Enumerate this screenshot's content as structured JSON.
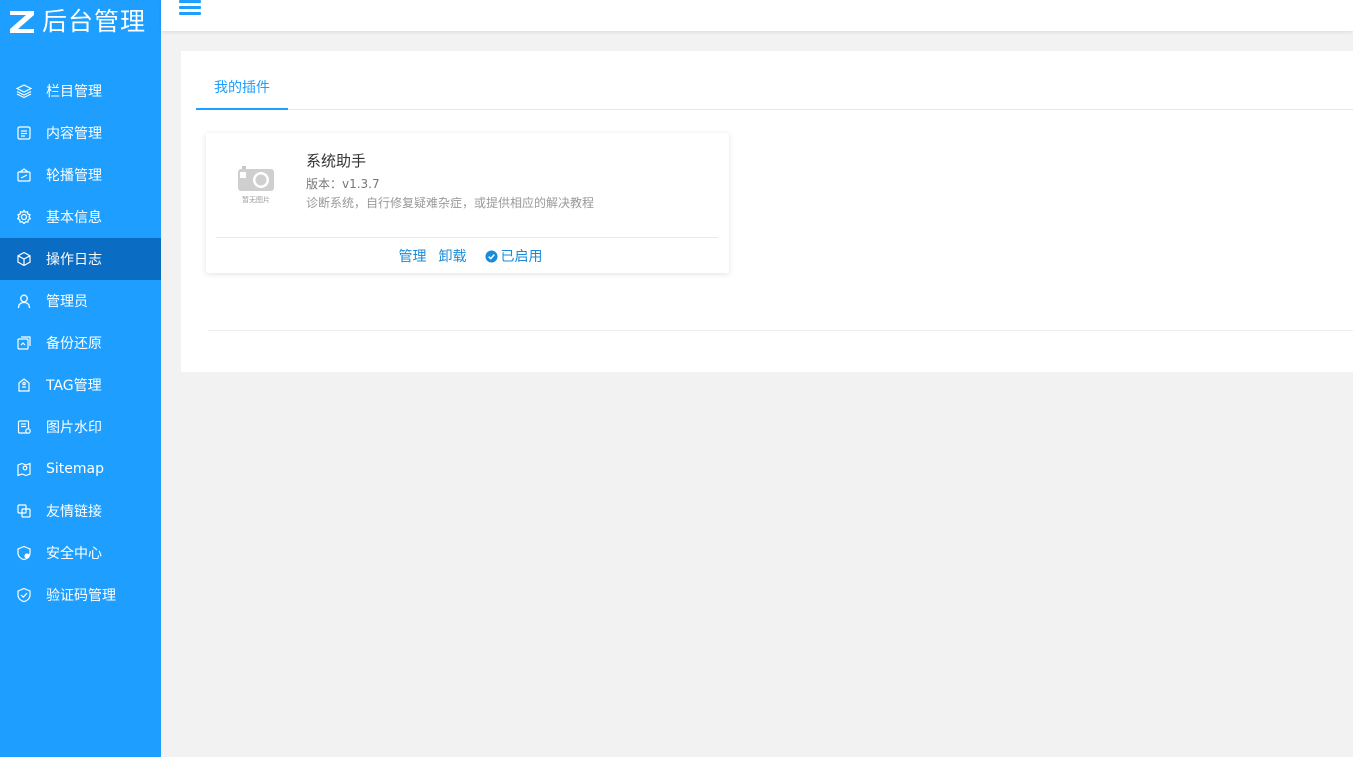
{
  "app": {
    "logo_text": "后台管理"
  },
  "sidebar": {
    "items": [
      {
        "label": "栏目管理",
        "icon": "layers-icon"
      },
      {
        "label": "内容管理",
        "icon": "document-icon"
      },
      {
        "label": "轮播管理",
        "icon": "carousel-icon"
      },
      {
        "label": "基本信息",
        "icon": "gear-icon"
      },
      {
        "label": "操作日志",
        "icon": "cube-icon",
        "active": true
      },
      {
        "label": "管理员",
        "icon": "user-icon"
      },
      {
        "label": "备份还原",
        "icon": "backup-icon"
      },
      {
        "label": "TAG管理",
        "icon": "tag-icon"
      },
      {
        "label": "图片水印",
        "icon": "watermark-icon"
      },
      {
        "label": "Sitemap",
        "icon": "map-icon"
      },
      {
        "label": "友情链接",
        "icon": "link-icon"
      },
      {
        "label": "安全中心",
        "icon": "security-shield-icon"
      },
      {
        "label": "验证码管理",
        "icon": "shield-check-icon"
      }
    ]
  },
  "header": {
    "menu_toggle_icon": "hamburger-icon"
  },
  "main": {
    "tabs": [
      {
        "label": "我的插件",
        "active": true
      }
    ],
    "plugins": [
      {
        "thumb_caption": "暂无图片",
        "name": "系统助手",
        "version": "版本：v1.3.7",
        "description": "诊断系统，自行修复疑难杂症，或提供相应的解决教程",
        "actions": {
          "manage": "管理",
          "uninstall": "卸载",
          "status": "已启用"
        }
      }
    ]
  },
  "colors": {
    "sidebar_bg": "#1e9fff",
    "sidebar_active": "#0b6cc4",
    "accent": "#1e9fff",
    "link": "#1a8bd8"
  }
}
